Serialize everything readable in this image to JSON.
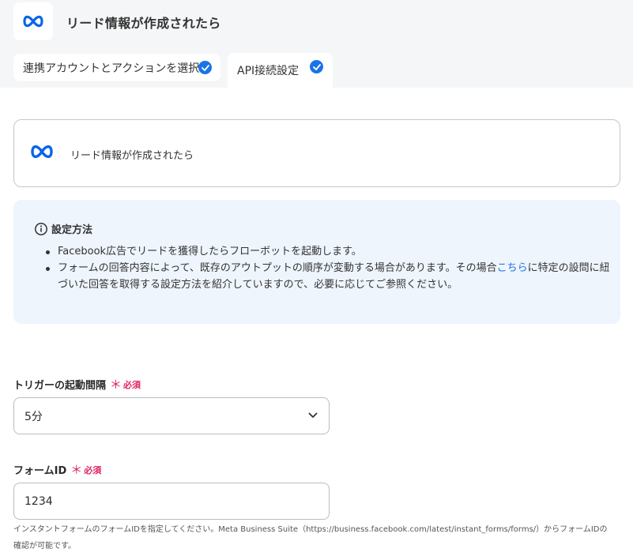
{
  "header": {
    "title": "リード情報が作成されたら",
    "logo_icon": "meta-logo-icon"
  },
  "tabs": [
    {
      "label": "連携アカウントとアクションを選択",
      "completed": true
    },
    {
      "label": "API接続設定",
      "completed": true,
      "active": true
    }
  ],
  "trigger_card": {
    "title": "リード情報が作成されたら"
  },
  "info": {
    "heading": "設定方法",
    "bullet1": "Facebook広告でリードを獲得したらフローボットを起動します。",
    "bullet2_before": "フォームの回答内容によって、既存のアウトプットの順序が変動する場合があります。その場合",
    "bullet2_link": "こちら",
    "bullet2_after": "に特定の設問に紐づいた回答を取得する設定方法を紹介していますので、必要に応じてご参照ください。"
  },
  "interval_field": {
    "label": "トリガーの起動間隔",
    "required_mark": "＊",
    "required_text": "必須",
    "value": "5分"
  },
  "form_id_field": {
    "label": "フォームID",
    "required_mark": "＊",
    "required_text": "必須",
    "value": "1234",
    "help": "インスタントフォームのフォームIDを指定してください。Meta Business Suite（https://business.facebook.com/latest/instant_forms/forms/）からフォームIDの確認が可能です。"
  },
  "colors": {
    "accent": "#1a73e8",
    "required": "#e0245e",
    "info_bg": "#eef5fd"
  }
}
